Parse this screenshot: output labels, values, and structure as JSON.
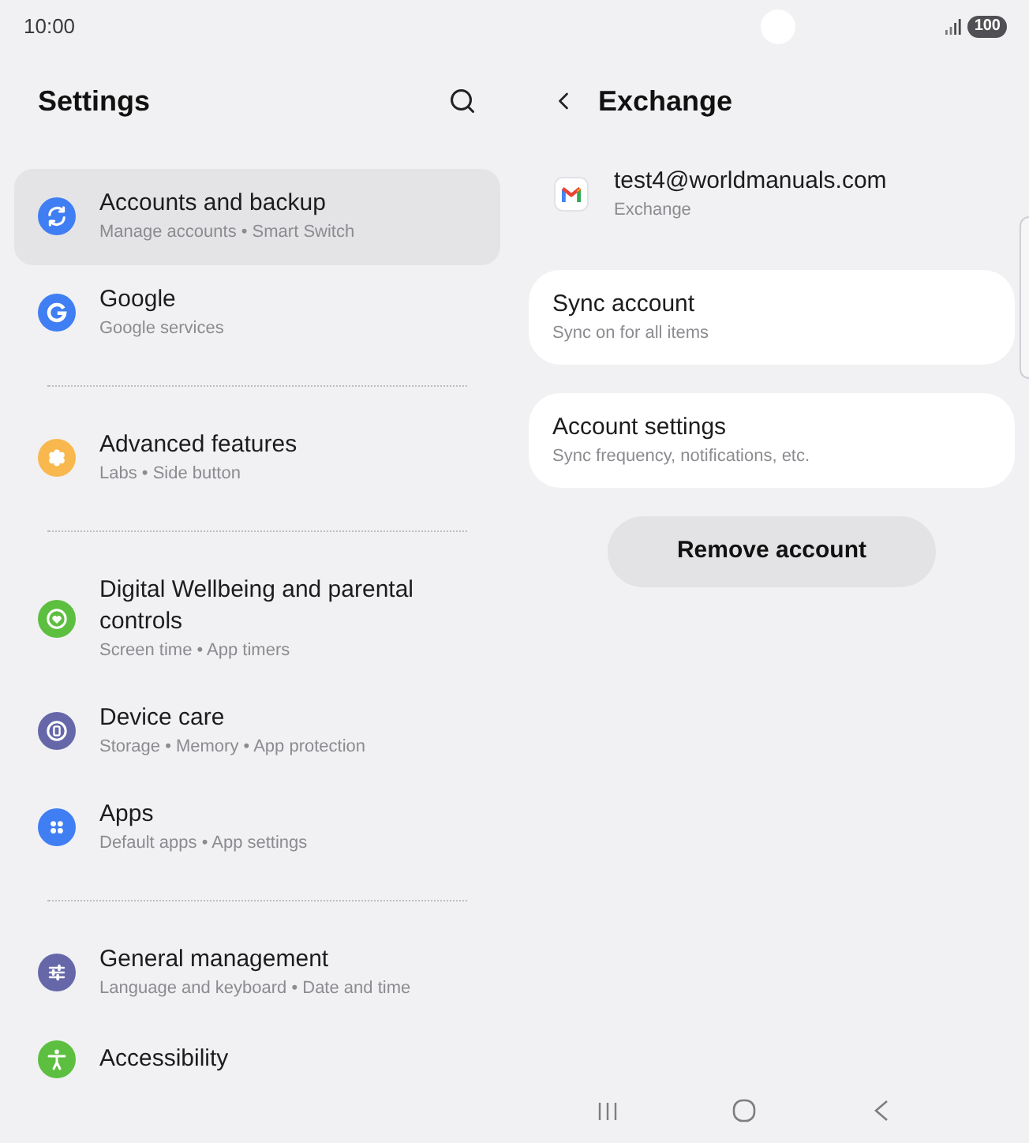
{
  "status_bar": {
    "time": "10:00",
    "battery": "100"
  },
  "settings_panel": {
    "title": "Settings",
    "groups": [
      [
        {
          "title": "Accounts and backup",
          "subtitle": "Manage accounts • Smart Switch",
          "color": "#3f7ef3",
          "selected": true
        },
        {
          "title": "Google",
          "subtitle": "Google services",
          "color": "#3f7ef3",
          "selected": false
        }
      ],
      [
        {
          "title": "Advanced features",
          "subtitle": "Labs • Side button",
          "color": "#f8b84e",
          "selected": false
        }
      ],
      [
        {
          "title": "Digital Wellbeing and parental controls",
          "subtitle": "Screen time • App timers",
          "color": "#5cbf3f",
          "selected": false
        },
        {
          "title": "Device care",
          "subtitle": "Storage • Memory • App protection",
          "color": "#6567a9",
          "selected": false
        },
        {
          "title": "Apps",
          "subtitle": "Default apps • App settings",
          "color": "#3f7ef3",
          "selected": false
        }
      ],
      [
        {
          "title": "General management",
          "subtitle": "Language and keyboard • Date and time",
          "color": "#6567a9",
          "selected": false
        },
        {
          "title": "Accessibility",
          "color": "#5cbf3f",
          "selected": false
        }
      ]
    ]
  },
  "account_panel": {
    "title": "Exchange",
    "email": "test4@worldmanuals.com",
    "type": "Exchange",
    "cards": [
      {
        "title": "Sync account",
        "subtitle": "Sync on for all items"
      },
      {
        "title": "Account settings",
        "subtitle": "Sync frequency, notifications, etc."
      }
    ],
    "remove_button": "Remove account"
  }
}
